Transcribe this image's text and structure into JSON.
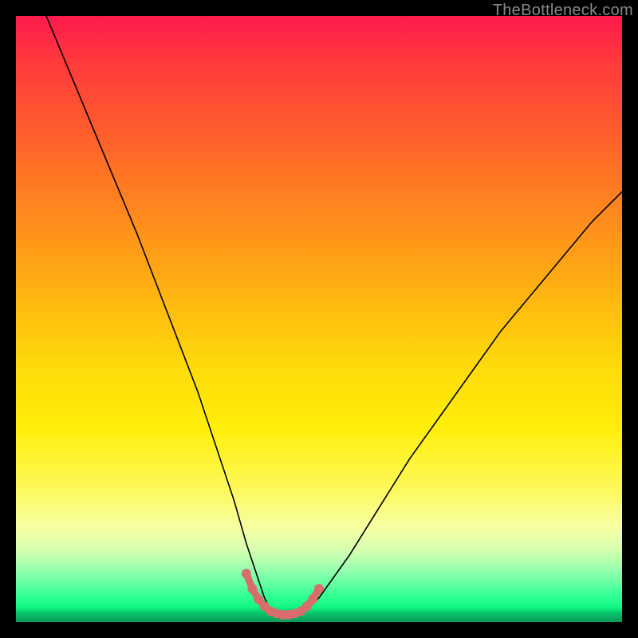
{
  "watermark": "TheBottleneck.com",
  "chart_data": {
    "type": "line",
    "title": "",
    "xlabel": "",
    "ylabel": "",
    "xlim": [
      0,
      100
    ],
    "ylim": [
      0,
      100
    ],
    "grid": false,
    "series": [
      {
        "name": "curve",
        "x": [
          5,
          10,
          15,
          20,
          25,
          30,
          33,
          36,
          38,
          40,
          41,
          42,
          43,
          44,
          45,
          46,
          48,
          50,
          55,
          60,
          65,
          70,
          75,
          80,
          85,
          90,
          95,
          100
        ],
        "y": [
          100,
          88,
          76,
          64,
          51,
          38,
          29,
          20,
          13,
          7,
          4,
          2,
          1.2,
          1,
          1,
          1.2,
          2,
          4,
          11,
          19,
          27,
          34,
          41,
          48,
          54,
          60,
          66,
          71
        ],
        "stroke": "#000000",
        "stroke_width": 1.6
      },
      {
        "name": "tolerance-band",
        "x": [
          38,
          39,
          40,
          41,
          42,
          43,
          44,
          45,
          46,
          47,
          48,
          49,
          50
        ],
        "y": [
          8,
          5.5,
          3.8,
          2.6,
          1.8,
          1.4,
          1.2,
          1.2,
          1.4,
          1.8,
          2.6,
          3.8,
          5.5
        ],
        "stroke": "#d96d6d",
        "stroke_width": 9
      },
      {
        "name": "tolerance-dots",
        "x": [
          38,
          39,
          40,
          41,
          42,
          43,
          44,
          45,
          46,
          47,
          48,
          49,
          50
        ],
        "y": [
          8,
          5.5,
          3.8,
          2.6,
          1.8,
          1.4,
          1.2,
          1.2,
          1.4,
          1.8,
          2.6,
          3.8,
          5.5
        ],
        "marker_color": "#d96d6d",
        "marker_radius": 6
      }
    ]
  }
}
